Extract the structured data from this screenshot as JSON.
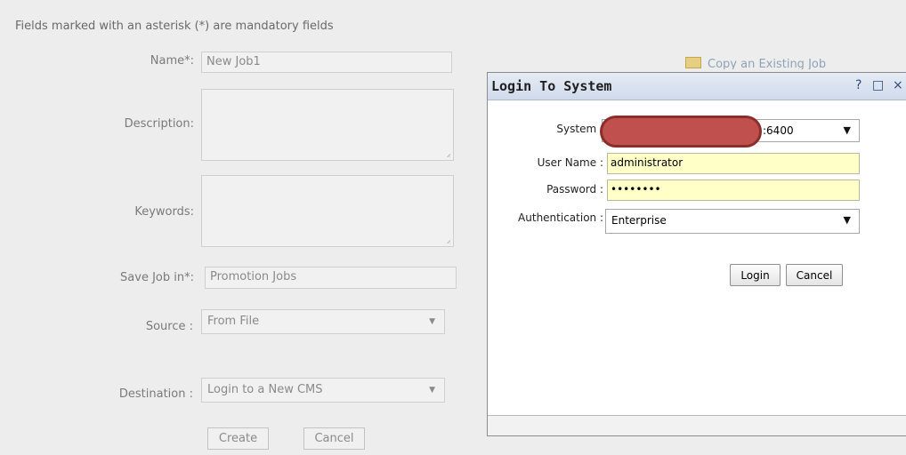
{
  "form": {
    "mandatory_note": "Fields marked with an asterisk (*) are mandatory fields",
    "name_label": "Name*:",
    "name_value": "New Job1",
    "description_label": "Description:",
    "keywords_label": "Keywords:",
    "save_job_label": "Save Job in*:",
    "save_job_value": "Promotion Jobs",
    "source_label": "Source :",
    "source_value": "From File",
    "destination_label": "Destination :",
    "destination_value": "Login to a New CMS",
    "create_label": "Create",
    "cancel_label": "Cancel",
    "copy_job_label": "Copy an Existing Job"
  },
  "dialog": {
    "title": "Login To System",
    "help_glyph": "?",
    "maximize_glyph": "□",
    "close_glyph": "×",
    "system_label": "System :",
    "system_value_visible": ":6400",
    "username_label": "User Name :",
    "username_value": "administrator",
    "password_label": "Password :",
    "password_value": "••••••••",
    "auth_label": "Authentication :",
    "auth_value": "Enterprise",
    "login_label": "Login",
    "cancel_label": "Cancel"
  },
  "icons": {
    "dropdown": "▼",
    "folder": "folder-icon"
  },
  "colors": {
    "dialog_header": "#cfdaeb",
    "input_highlight": "#ffffc8",
    "redaction": "#c0504d"
  }
}
